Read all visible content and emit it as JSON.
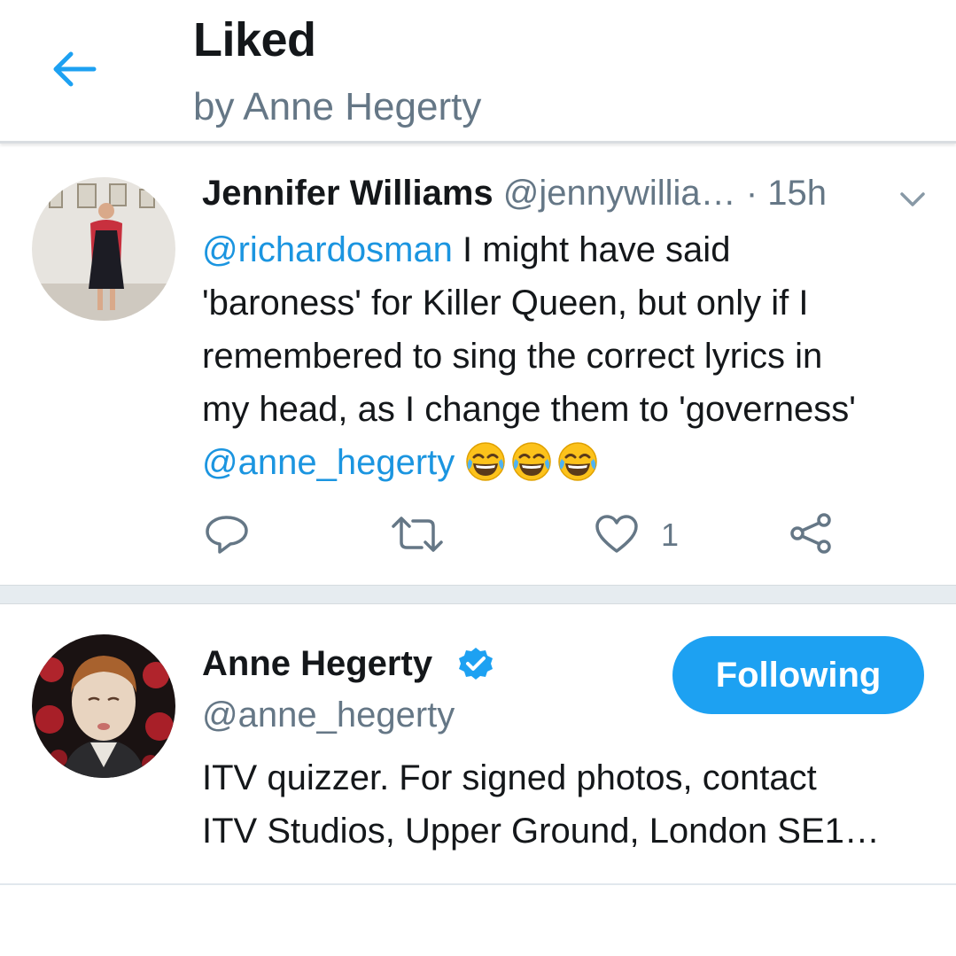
{
  "header": {
    "title": "Liked",
    "subtitle": "by Anne Hegerty",
    "back_icon": "arrow-left-icon"
  },
  "tweet": {
    "author_name": "Jennifer Williams",
    "author_handle": "@jennywillia…",
    "separator": "·",
    "time": "15h",
    "text": {
      "mention_1": "@richardosman",
      "line_1_rest": " I might have said",
      "line_2": "'baroness' for Killer Queen, but only if I",
      "line_3": "remembered to sing the correct lyrics in",
      "line_4": "my head, as I change them to 'governess'",
      "mention_2": "@anne_hegerty",
      "emoji": [
        "face-with-tears-of-joy",
        "face-with-tears-of-joy",
        "face-with-tears-of-joy"
      ]
    },
    "actions": {
      "reply_icon": "reply-icon",
      "retweet_icon": "retweet-icon",
      "like_icon": "heart-icon",
      "like_count": "1",
      "share_icon": "share-icon"
    }
  },
  "user": {
    "name": "Anne Hegerty",
    "verified_icon": "verified-badge-icon",
    "handle": "@anne_hegerty",
    "follow_button": "Following",
    "bio_line_1": "ITV quizzer. For signed photos, contact",
    "bio_line_2": "ITV Studios, Upper Ground, London SE1…"
  },
  "colors": {
    "accent": "#1da1f2",
    "link": "#1b95e0",
    "secondary_text": "#657786",
    "separator": "#e6ecf0"
  }
}
